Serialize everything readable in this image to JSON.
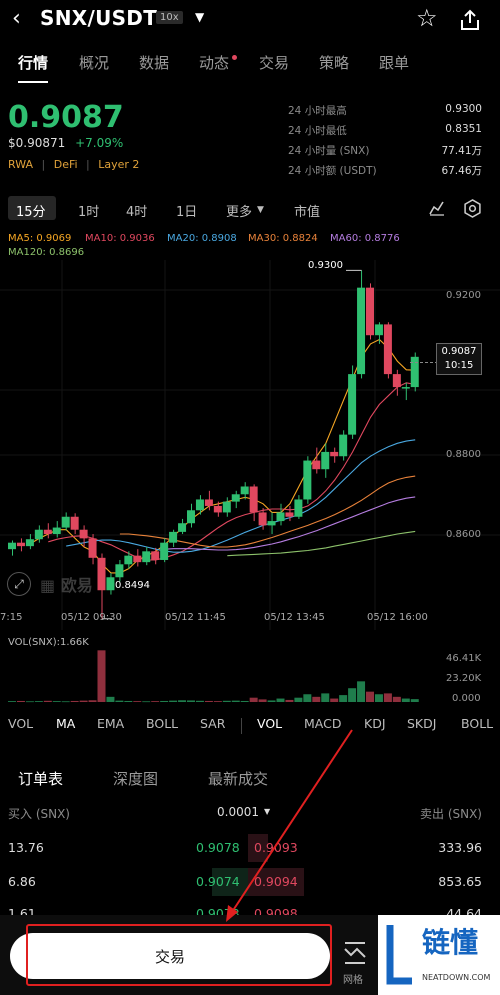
{
  "header": {
    "title": "SNX/USDT",
    "leverage": "10x"
  },
  "nav": {
    "tabs": [
      "行情",
      "概况",
      "数据",
      "动态",
      "交易",
      "策略",
      "跟单"
    ],
    "active": 0
  },
  "price": {
    "last": "0.9087",
    "usd": "$0.90871",
    "change": "+7.09%",
    "tags": [
      "RWA",
      "DeFi",
      "Layer 2"
    ]
  },
  "stats": [
    {
      "label": "24 小时最高",
      "value": "0.9300"
    },
    {
      "label": "24 小时最低",
      "value": "0.8351"
    },
    {
      "label": "24 小时量 (SNX)",
      "value": "77.41万"
    },
    {
      "label": "24 小时额 (USDT)",
      "value": "67.46万"
    }
  ],
  "timeframes": {
    "items": [
      "15分",
      "1时",
      "4时",
      "1日",
      "更多",
      "市值"
    ],
    "active": "15分"
  },
  "ma_indicators": [
    {
      "label": "MA5: 0.9069",
      "color": "#f5a623"
    },
    {
      "label": "MA10: 0.9036",
      "color": "#e0485f"
    },
    {
      "label": "MA20: 0.8908",
      "color": "#4aa8e0"
    },
    {
      "label": "MA30: 0.8824",
      "color": "#e8823a"
    },
    {
      "label": "MA60: 0.8776",
      "color": "#b57de0"
    },
    {
      "label": "MA120: 0.8696",
      "color": "#8dc26b"
    }
  ],
  "chart_data": {
    "type": "candlestick",
    "y_axis_labels": [
      "0.9200",
      "0.8800",
      "0.8600"
    ],
    "x_axis_labels": [
      "7:15",
      "05/12 09:30",
      "05/12 11:45",
      "05/12 13:45",
      "05/12 16:00"
    ],
    "high_label": "0.9300",
    "low_label": "0.8494",
    "current_label": {
      "price": "0.9087",
      "countdown": "10:15"
    },
    "ylim": [
      0.8468,
      0.9324
    ],
    "candles": [
      [
        0.8655,
        0.867,
        0.864,
        0.8675
      ],
      [
        0.867,
        0.8662,
        0.865,
        0.868
      ],
      [
        0.8662,
        0.8678,
        0.8655,
        0.869
      ],
      [
        0.8678,
        0.87,
        0.867,
        0.871
      ],
      [
        0.87,
        0.869,
        0.868,
        0.8715
      ],
      [
        0.869,
        0.8705,
        0.8682,
        0.872
      ],
      [
        0.8705,
        0.873,
        0.8698,
        0.874
      ],
      [
        0.873,
        0.87,
        0.869,
        0.8738
      ],
      [
        0.87,
        0.868,
        0.866,
        0.871
      ],
      [
        0.868,
        0.8635,
        0.862,
        0.869
      ],
      [
        0.8635,
        0.856,
        0.8494,
        0.8645
      ],
      [
        0.856,
        0.859,
        0.855,
        0.86
      ],
      [
        0.859,
        0.862,
        0.858,
        0.863
      ],
      [
        0.862,
        0.864,
        0.861,
        0.865
      ],
      [
        0.864,
        0.8625,
        0.8615,
        0.8655
      ],
      [
        0.8625,
        0.865,
        0.8618,
        0.866
      ],
      [
        0.865,
        0.863,
        0.862,
        0.8658
      ],
      [
        0.863,
        0.867,
        0.8625,
        0.868
      ],
      [
        0.867,
        0.8695,
        0.866,
        0.87
      ],
      [
        0.8695,
        0.8715,
        0.869,
        0.8725
      ],
      [
        0.8715,
        0.8745,
        0.8705,
        0.876
      ],
      [
        0.8745,
        0.877,
        0.8735,
        0.878
      ],
      [
        0.877,
        0.8755,
        0.8745,
        0.879
      ],
      [
        0.8755,
        0.874,
        0.873,
        0.8765
      ],
      [
        0.874,
        0.8765,
        0.873,
        0.8775
      ],
      [
        0.8765,
        0.8782,
        0.875,
        0.879
      ],
      [
        0.8782,
        0.88,
        0.877,
        0.881
      ],
      [
        0.88,
        0.874,
        0.872,
        0.8805
      ],
      [
        0.874,
        0.871,
        0.87,
        0.875
      ],
      [
        0.871,
        0.872,
        0.869,
        0.874
      ],
      [
        0.872,
        0.874,
        0.871,
        0.876
      ],
      [
        0.874,
        0.873,
        0.872,
        0.8755
      ],
      [
        0.873,
        0.877,
        0.8725,
        0.878
      ],
      [
        0.877,
        0.886,
        0.876,
        0.887
      ],
      [
        0.886,
        0.884,
        0.883,
        0.889
      ],
      [
        0.884,
        0.888,
        0.882,
        0.89
      ],
      [
        0.888,
        0.887,
        0.8855,
        0.889
      ],
      [
        0.887,
        0.892,
        0.886,
        0.893
      ],
      [
        0.892,
        0.906,
        0.891,
        0.908
      ],
      [
        0.906,
        0.926,
        0.905,
        0.93
      ],
      [
        0.926,
        0.915,
        0.914,
        0.927
      ],
      [
        0.915,
        0.9175,
        0.913,
        0.918
      ],
      [
        0.9175,
        0.906,
        0.905,
        0.918
      ],
      [
        0.906,
        0.903,
        0.901,
        0.907
      ],
      [
        0.903,
        0.903,
        0.9,
        0.904
      ],
      [
        0.903,
        0.91,
        0.902,
        0.911
      ]
    ],
    "ma_series": [
      {
        "name": "MA5",
        "color": "#f5a623",
        "values": [
          0.8668,
          0.868,
          0.869,
          0.87,
          0.87,
          0.868,
          0.866,
          0.865,
          0.862,
          0.86,
          0.86,
          0.861,
          0.863,
          0.864,
          0.865,
          0.8665,
          0.8685,
          0.8705,
          0.8725,
          0.874,
          0.8755,
          0.876,
          0.8765,
          0.877,
          0.8775,
          0.877,
          0.876,
          0.874,
          0.874,
          0.876,
          0.88,
          0.884,
          0.887,
          0.89,
          0.895,
          0.9,
          0.905,
          0.91,
          0.913,
          0.914,
          0.912,
          0.909,
          0.907,
          0.9069
        ]
      },
      {
        "name": "MA10",
        "color": "#e0485f",
        "values": [
          0.8672,
          0.8678,
          0.8682,
          0.8685,
          0.8686,
          0.868,
          0.8672,
          0.8665,
          0.8655,
          0.8645,
          0.8635,
          0.863,
          0.863,
          0.8635,
          0.8642,
          0.865,
          0.8662,
          0.8675,
          0.869,
          0.8705,
          0.8718,
          0.8728,
          0.8735,
          0.874,
          0.8745,
          0.8748,
          0.8748,
          0.8746,
          0.8748,
          0.8755,
          0.877,
          0.879,
          0.8815,
          0.8845,
          0.888,
          0.892,
          0.896,
          0.899,
          0.901,
          0.903,
          0.904,
          0.9036
        ]
      },
      {
        "name": "MA20",
        "color": "#4aa8e0",
        "values": [
          0.8662,
          0.8666,
          0.867,
          0.8674,
          0.8676,
          0.8676,
          0.8674,
          0.867,
          0.8665,
          0.866,
          0.8655,
          0.8651,
          0.8648,
          0.8648,
          0.865,
          0.8654,
          0.866,
          0.8668,
          0.8676,
          0.8685,
          0.8694,
          0.8702,
          0.871,
          0.8716,
          0.8722,
          0.8728,
          0.8735,
          0.8745,
          0.8758,
          0.8775,
          0.8795,
          0.8815,
          0.8835,
          0.8855,
          0.887,
          0.8882,
          0.8892,
          0.89,
          0.8905,
          0.8908
        ]
      },
      {
        "name": "MA30",
        "color": "#e8823a",
        "values": [
          0.869,
          0.869,
          0.8688,
          0.8686,
          0.8683,
          0.868,
          0.8676,
          0.8672,
          0.8668,
          0.8664,
          0.8661,
          0.866,
          0.866,
          0.8662,
          0.8665,
          0.867,
          0.8676,
          0.8682,
          0.8689,
          0.8696,
          0.8703,
          0.871,
          0.8718,
          0.8726,
          0.8735,
          0.8745,
          0.8756,
          0.8768,
          0.8782,
          0.8796,
          0.8808,
          0.8816,
          0.8821,
          0.8824
        ]
      },
      {
        "name": "MA60",
        "color": "#b57de0",
        "values": [
          0.8655,
          0.8656,
          0.8656,
          0.8656,
          0.8655,
          0.8654,
          0.8653,
          0.8653,
          0.8654,
          0.8656,
          0.8659,
          0.8663,
          0.8667,
          0.8672,
          0.8678,
          0.8684,
          0.8691,
          0.8698,
          0.8706,
          0.8714,
          0.8722,
          0.873,
          0.8738,
          0.8746,
          0.8754,
          0.8762,
          0.8768,
          0.8773,
          0.8776
        ]
      },
      {
        "name": "MA120",
        "color": "#8dc26b",
        "values": [
          0.864,
          0.8641,
          0.8642,
          0.8643,
          0.8644,
          0.8645,
          0.8646,
          0.8648,
          0.865,
          0.8652,
          0.8655,
          0.8658,
          0.8662,
          0.8666,
          0.867,
          0.8674,
          0.8678,
          0.8682,
          0.8686,
          0.869,
          0.8693,
          0.8696
        ]
      }
    ]
  },
  "volume": {
    "label": "VOL(SNX):1.66K",
    "axis": [
      "46.41K",
      "23.20K",
      "0.000"
    ],
    "values": [
      0.5,
      0.6,
      0.4,
      0.5,
      0.7,
      0.5,
      0.4,
      0.6,
      0.8,
      1.0,
      30.0,
      3.0,
      0.8,
      0.6,
      0.5,
      0.4,
      0.5,
      0.6,
      0.8,
      1.0,
      0.9,
      0.7,
      0.6,
      0.5,
      0.7,
      0.8,
      0.6,
      2.5,
      1.5,
      0.9,
      2.0,
      1.2,
      2.5,
      4.5,
      3.0,
      5.0,
      2.0,
      4.0,
      8.0,
      12.0,
      6.0,
      4.5,
      5.0,
      3.0,
      2.0,
      1.66
    ]
  },
  "indicator_tabs": {
    "main": [
      "VOL",
      "MA",
      "EMA",
      "BOLL",
      "SAR"
    ],
    "sub": [
      "VOL",
      "MACD",
      "KDJ",
      "SKDJ",
      "BOLL"
    ],
    "active_main": "MA",
    "active_sub": "VOL"
  },
  "order_tabs": {
    "items": [
      "订单表",
      "深度图",
      "最新成交"
    ],
    "active": 0
  },
  "orderbook": {
    "buy_header": "买入 (SNX)",
    "precision": "0.0001",
    "sell_header": "卖出 (SNX)",
    "rows": [
      {
        "buy_qty": "13.76",
        "buy_price": "0.9078",
        "sell_price": "0.9093",
        "sell_qty": "333.96"
      },
      {
        "buy_qty": "6.86",
        "buy_price": "0.9074",
        "sell_price": "0.9094",
        "sell_qty": "853.65"
      },
      {
        "buy_qty": "1.61",
        "buy_price": "0.9073",
        "sell_price": "0.9098",
        "sell_qty": "44.64"
      }
    ]
  },
  "bottom": {
    "trade_label": "交易",
    "grid_label": "网格"
  },
  "watermark": {
    "logo_text": "链懂",
    "domain": "NEATDOWN.COM"
  },
  "chart_watermark": "欧易"
}
